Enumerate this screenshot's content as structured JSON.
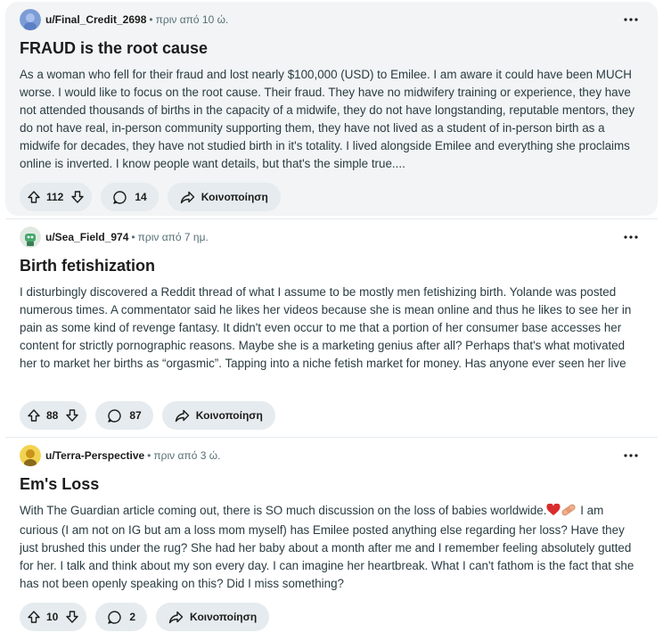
{
  "posts": [
    {
      "author": "u/Final_Credit_2698",
      "separator": "•",
      "time": "πριν από 10 ώ.",
      "title": "FRAUD is the root cause",
      "body": "As a woman who fell for their fraud and lost nearly $100,000 (USD) to Emilee. I am aware it could have been MUCH worse. I would like to focus on the root cause. Their fraud. They have no midwifery training or experience, they have not attended thousands of births in the capacity of a midwife, they do not have longstanding, reputable mentors, they do not have real, in-person community supporting them, they have not lived as a student of in-person birth as a midwife for decades, they have not studied birth in it's totality. I lived alongside Emilee and everything she proclaims online is inverted. I know people want details, but that's the simple true....",
      "votes": "112",
      "comments": "14",
      "share": "Κοινοποίηση",
      "avatar_icon": "blue-avatar-icon"
    },
    {
      "author": "u/Sea_Field_974",
      "separator": "•",
      "time": "πριν από 7 ημ.",
      "title": "Birth fetishization",
      "body": "I disturbingly discovered a Reddit thread of what I assume to be mostly men fetishizing birth. Yolande was posted numerous times. A commentator said he likes her videos because she is mean online and thus he likes to see her in pain as some kind of revenge fantasy. It didn't even occur to me that a portion of her consumer base accesses her content for strictly pornographic reasons. Maybe she is a marketing genius after all? Perhaps that's what motivated her to market her births as “orgasmic”. Tapping into a niche fetish market for money. Has anyone ever seen her live births? Another commentator discussed how much she defecated during birth and how that elicite...",
      "votes": "88",
      "comments": "87",
      "share": "Κοινοποίηση",
      "avatar_icon": "green-avatar-icon"
    },
    {
      "author": "u/Terra-Perspective",
      "separator": "•",
      "time": "πριν από 3 ώ.",
      "title": "Em's Loss",
      "body_before_emoji": "With The Guardian article coming out, there is SO much discussion on the loss of babies worldwide.",
      "body_after_emoji": " I am curious (I am not on IG but am a loss mom myself) has Emilee posted anything else regarding her loss? Have they just brushed this under the rug? She had her baby about a month after me and I remember feeling absolutely gutted for her. I talk and think about my son every day. I can imagine her heartbreak. What I can't fathom is the fact that she has not been openly speaking on this? Did I miss something?",
      "emoji_icons": [
        "red-heart-icon",
        "bandage-icon"
      ],
      "votes": "10",
      "comments": "2",
      "share": "Κοινοποίηση",
      "avatar_icon": "yellow-avatar-icon"
    }
  ],
  "colors": {
    "hover_bg": "#f2f4f5",
    "pill_bg": "#e5ebee",
    "meta_text": "#576f76",
    "body_text": "#2a3c42"
  }
}
